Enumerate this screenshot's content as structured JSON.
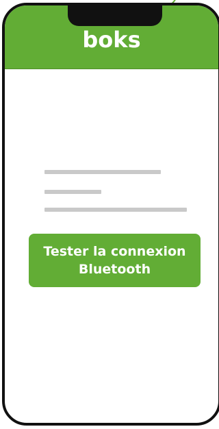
{
  "app": {
    "brand": "boks"
  },
  "main": {
    "button": {
      "line1": "Tester la connexion",
      "line2": "Bluetooth"
    }
  },
  "colors": {
    "accent": "#62ad35",
    "frame": "#111111",
    "placeholder_line": "#c9c9c9"
  }
}
